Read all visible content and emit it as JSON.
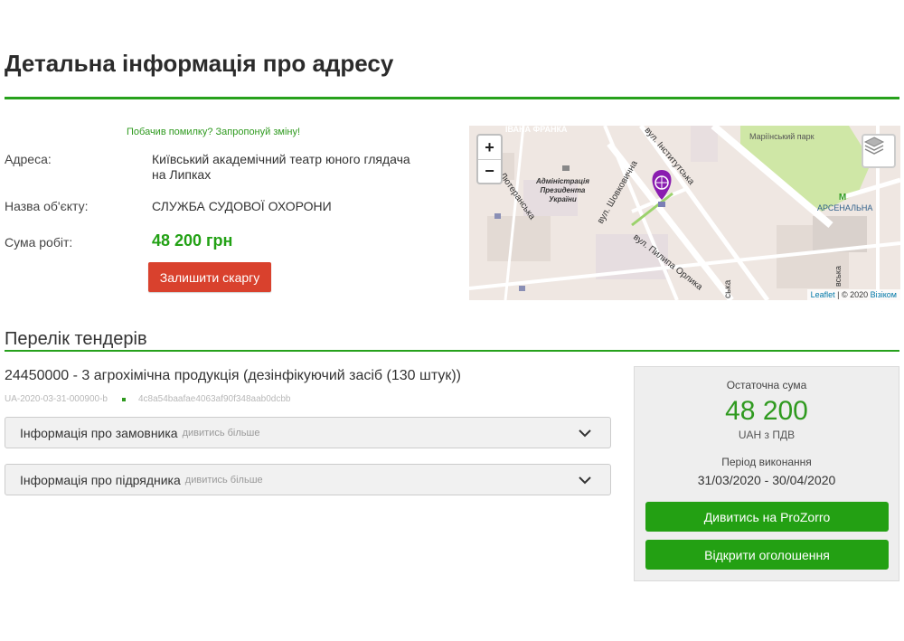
{
  "page": {
    "title": "Детальна інформація про адресу"
  },
  "suggest_link": "Побачив помилку? Запропонуй зміну!",
  "info": {
    "address_label": "Адреса:",
    "address_line1": "Київський академічний театр юного глядача",
    "address_line2": "на Липках",
    "object_label": "Назва об'єкту:",
    "object_value": "СЛУЖБА СУДОВОЇ ОХОРОНИ",
    "sum_label": "Сума робіт:",
    "sum_value": "48 200 грн",
    "complaint_button": "Залишити скаргу"
  },
  "map": {
    "zoom_in": "+",
    "zoom_out": "−",
    "labels": {
      "ivana_franka": "ІВАНА ФРАНКА",
      "instytutska": "вул. Інститутська",
      "marinskyi_park": "Маріїнський парк",
      "admin_line1": "Адміністрація",
      "admin_line2": "Президента",
      "admin_line3": "України",
      "shovkovychna": "вул. Шовковична",
      "lyuteranska": "Лютеранська",
      "arsenalna": "АРСЕНАЛЬНА",
      "metro": "M",
      "orlyka": "вул. Пилипа Орлика",
      "side_street_1": "ська",
      "side_street_2": "вська"
    },
    "attribution": {
      "leaflet": "Leaflet",
      "separator": " | © 2020 ",
      "visicom": "Візіком"
    },
    "colors": {
      "background": "#efe7e2",
      "park": "#cfe7a6",
      "marker": "#8a1db0"
    }
  },
  "tenders": {
    "section_title": "Перелік тендерів",
    "title": "24450000 - 3 агрохімічна продукція (дезінфікуючий засіб (130 штук))",
    "tender_id": "UA-2020-03-31-000900-b",
    "hash": "4c8a54baafae4063af90f348aab0dcbb",
    "customer_label": "Інформація про замовника",
    "customer_more": "дивитись більше",
    "contractor_label": "Інформація про підрядника",
    "contractor_more": "дивитись більше"
  },
  "summary": {
    "final_sum_label": "Остаточна сума",
    "final_sum": "48 200",
    "currency": "UAH з ПДВ",
    "period_label": "Період виконання",
    "period": "31/03/2020 - 30/04/2020",
    "prozorro_button": "Дивитись на ProZorro",
    "announcement_button": "Відкрити оголошення"
  },
  "colors": {
    "accent_green": "#27a11c",
    "button_green": "#23a013",
    "button_red": "#d9412d"
  }
}
